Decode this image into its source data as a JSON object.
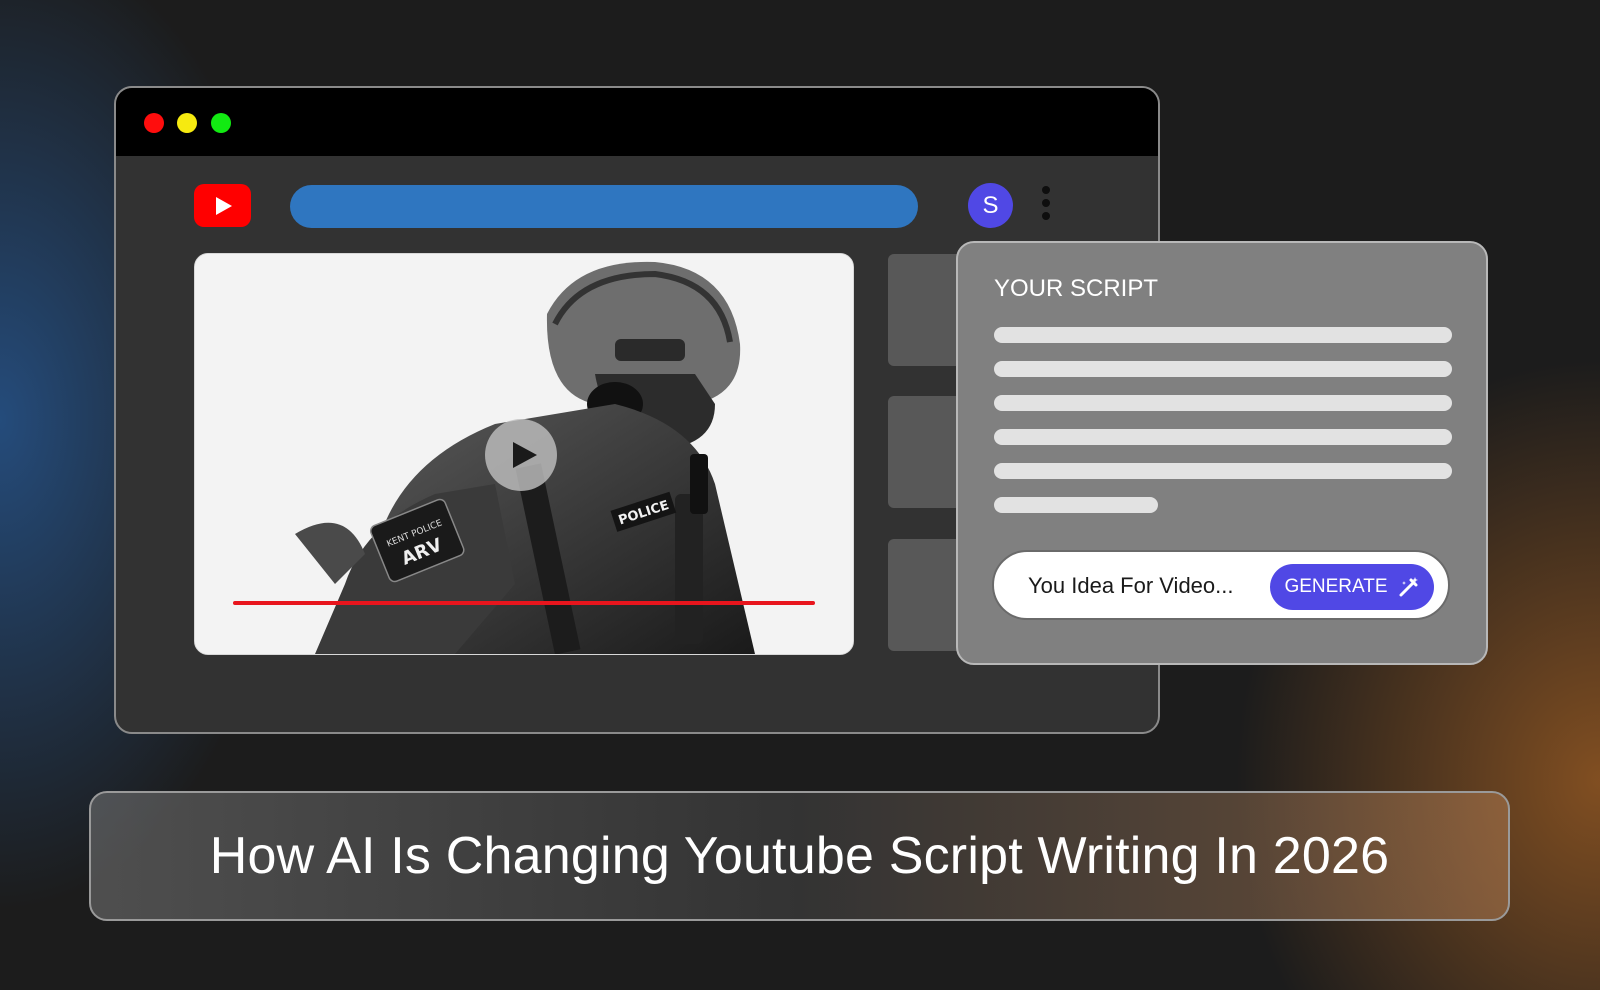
{
  "browser": {
    "window_controls": [
      "close",
      "minimize",
      "maximize"
    ],
    "logo_icon": "youtube-play-icon",
    "avatar_initial": "S",
    "menu_icon": "vertical-dots-icon",
    "video": {
      "patch_text_1": "ARV",
      "patch_text_2": "KENT POLICE",
      "vest_text": "POLICE",
      "play_icon": "play-icon"
    }
  },
  "script_panel": {
    "title": "YOUR SCRIPT",
    "idea_placeholder": "You Idea For Video...",
    "generate_label": "GENERATE",
    "generate_icon": "magic-wand-icon"
  },
  "headline": "How AI Is Changing Youtube Script Writing In 2026",
  "colors": {
    "accent": "#5048e5",
    "search_bar": "#2f76c0",
    "youtube_red": "#ff0000",
    "progress_red": "#e8151d"
  }
}
